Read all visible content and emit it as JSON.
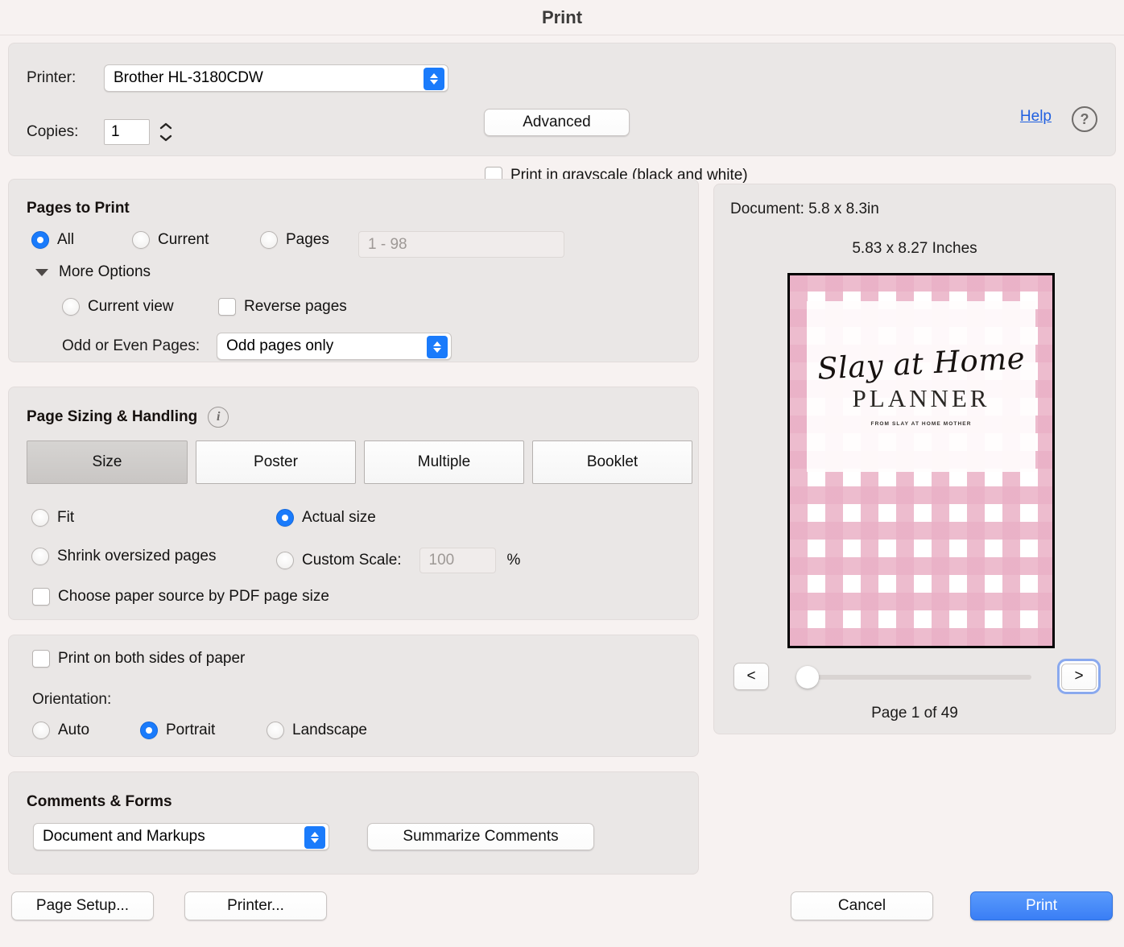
{
  "window": {
    "title": "Print"
  },
  "printer": {
    "label": "Printer:",
    "selected": "Brother HL-3180CDW",
    "advanced_label": "Advanced",
    "copies_label": "Copies:",
    "copies_value": "1",
    "grayscale_label": "Print in grayscale (black and white)",
    "grayscale_checked": false,
    "help_label": "Help",
    "help_icon": "question-mark-icon"
  },
  "pages_to_print": {
    "title": "Pages to Print",
    "options": [
      {
        "label": "All",
        "selected": true
      },
      {
        "label": "Current",
        "selected": false
      },
      {
        "label": "Pages",
        "selected": false
      }
    ],
    "range_placeholder": "1 - 98",
    "more_options_label": "More Options",
    "more_options_expanded": true,
    "current_view_label": "Current view",
    "reverse_pages_label": "Reverse pages",
    "odd_even_label": "Odd or Even Pages:",
    "odd_even_value": "Odd pages only"
  },
  "page_sizing": {
    "title": "Page Sizing & Handling",
    "info_icon": "info-icon",
    "tabs": [
      {
        "label": "Size",
        "active": true
      },
      {
        "label": "Poster",
        "active": false
      },
      {
        "label": "Multiple",
        "active": false
      },
      {
        "label": "Booklet",
        "active": false
      }
    ],
    "fit_label": "Fit",
    "actual_size_label": "Actual size",
    "actual_size_selected": true,
    "shrink_label": "Shrink oversized pages",
    "custom_scale_label": "Custom Scale:",
    "custom_scale_value": "100",
    "percent_symbol": "%",
    "paper_source_label": "Choose paper source by PDF page size"
  },
  "duplex": {
    "both_sides_label": "Print on both sides of paper",
    "orientation_label": "Orientation:",
    "orientations": [
      {
        "label": "Auto",
        "selected": false
      },
      {
        "label": "Portrait",
        "selected": true
      },
      {
        "label": "Landscape",
        "selected": false
      }
    ]
  },
  "comments_forms": {
    "title": "Comments & Forms",
    "selected": "Document and Markups",
    "summarize_label": "Summarize Comments"
  },
  "preview": {
    "document_size": "Document: 5.8 x 8.3in",
    "paper_size": "5.83 x 8.27 Inches",
    "thumbnail": {
      "script_title": "Slay at Home",
      "main_title": "PLANNER",
      "subtitle": "FROM SLAY AT HOME MOTHER"
    },
    "prev_label": "<",
    "next_label": ">",
    "page_status": "Page 1 of 49"
  },
  "footer": {
    "page_setup_label": "Page Setup...",
    "printer_label": "Printer...",
    "cancel_label": "Cancel",
    "print_label": "Print"
  },
  "colors": {
    "accent_blue": "#1a7bfb",
    "print_button": "#3a7ef5",
    "link_blue": "#1f5fe0",
    "panel_bg": "#eae7e6",
    "window_bg": "#f7f2f1",
    "gingham_pink": "#eab0c6"
  }
}
